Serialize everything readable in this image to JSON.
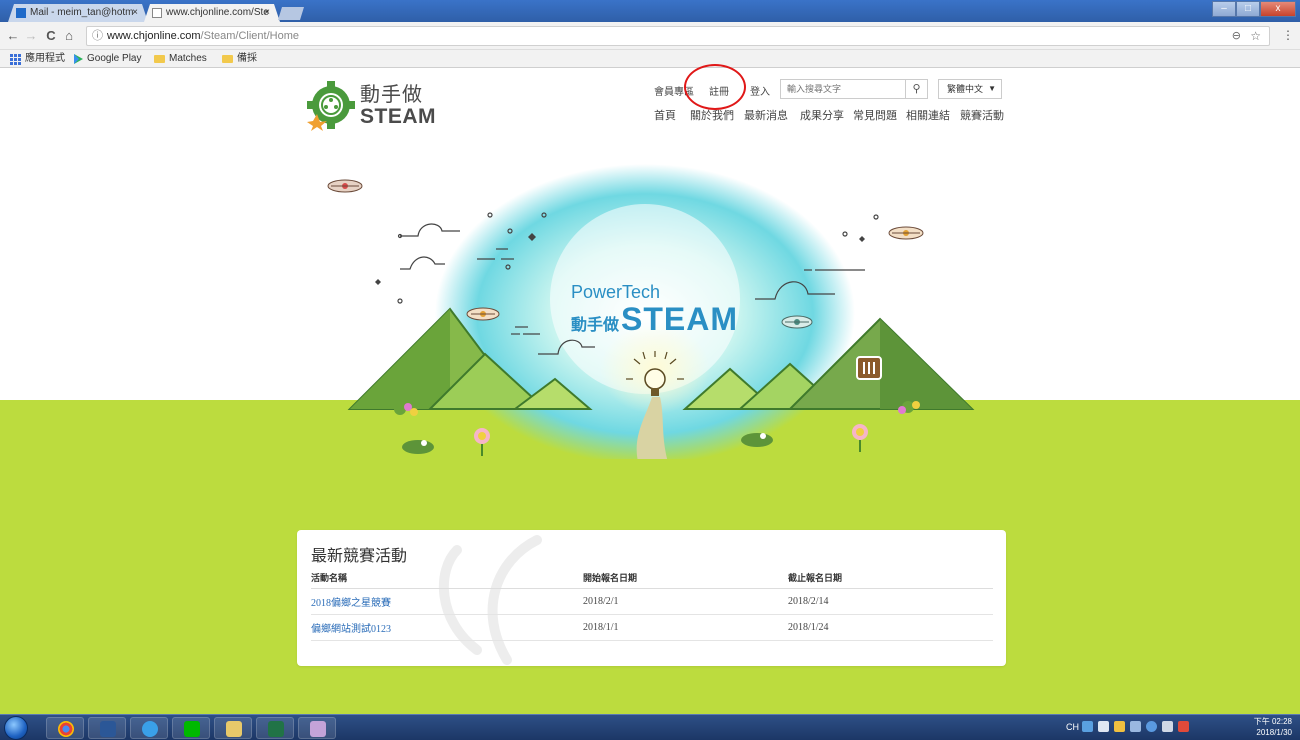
{
  "browser": {
    "tabs": [
      {
        "label": "Mail - meim_tan@hotm",
        "active": false
      },
      {
        "label": "www.chjonline.com/Ste",
        "active": true
      }
    ],
    "tab_close": "×",
    "window_buttons": {
      "minimize": "–",
      "maximize": "□",
      "close": "x"
    },
    "nav": {
      "back": "←",
      "forward": "→",
      "reload": "C",
      "home": "⌂"
    },
    "url_host": "www.chjonline.com",
    "url_path": "/Steam/Client/Home",
    "zoom_icon": "⊖",
    "star_icon": "☆",
    "menu_icon": "⋮",
    "bookmarks": [
      {
        "label": "應用程式",
        "icon": "apps-grid-icon"
      },
      {
        "label": "Google Play",
        "icon": "play-icon"
      },
      {
        "label": "Matches",
        "icon": "folder-icon"
      },
      {
        "label": "備採",
        "icon": "folder-icon"
      }
    ]
  },
  "site": {
    "logo_line1": "動手做",
    "logo_line2": "STEAM",
    "top_links": {
      "member": "會員專區",
      "register": "註冊",
      "login": "登入"
    },
    "search_placeholder": "輸入搜尋文字",
    "search_icon": "🔍",
    "language": "繁體中文",
    "language_arrow": "▼",
    "nav": [
      "首頁",
      "關於我們",
      "最新消息",
      "成果分享",
      "常見問題",
      "相關連結",
      "競賽活動"
    ],
    "hero": {
      "line1": "PowerTech",
      "line2_cn": "動手做",
      "line2_en": "STEAM"
    },
    "accent_color": "#2a8fc4",
    "ground_color": "#bcdc3e"
  },
  "competitions": {
    "title": "最新競賽活動",
    "columns": [
      "活動名稱",
      "開始報名日期",
      "截止報名日期"
    ],
    "rows": [
      {
        "name": "2018偏鄉之星競賽",
        "start": "2018/2/1",
        "end": "2018/2/14"
      },
      {
        "name": "偏鄉網站測試0123",
        "start": "2018/1/1",
        "end": "2018/1/24"
      }
    ]
  },
  "taskbar": {
    "apps": [
      "chrome-icon",
      "word-icon",
      "ie-icon",
      "line-icon",
      "explorer-icon",
      "excel-icon",
      "paint-icon"
    ],
    "ime": "CH",
    "time": "下午 02:28",
    "date": "2018/1/30"
  }
}
